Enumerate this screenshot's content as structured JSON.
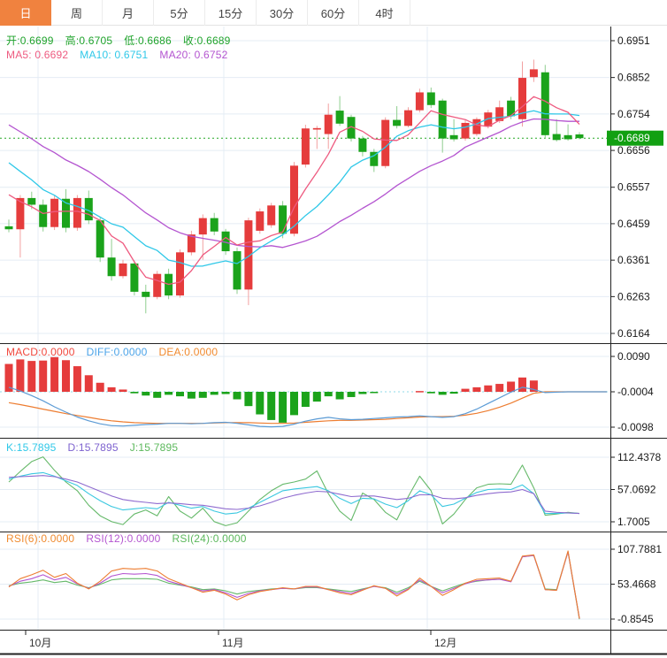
{
  "toolbar": {
    "tabs": [
      {
        "label": "日",
        "active": true
      },
      {
        "label": "周",
        "active": false
      },
      {
        "label": "月",
        "active": false
      },
      {
        "label": "5分",
        "active": false
      },
      {
        "label": "15分",
        "active": false
      },
      {
        "label": "30分",
        "active": false
      },
      {
        "label": "60分",
        "active": false
      },
      {
        "label": "4时",
        "active": false
      }
    ]
  },
  "legends": {
    "ohlc": [
      {
        "text": "开:0.6699",
        "color": "#1fa32b"
      },
      {
        "text": "高:0.6705",
        "color": "#1fa32b"
      },
      {
        "text": "低:0.6686",
        "color": "#1fa32b"
      },
      {
        "text": "收:0.6689",
        "color": "#1fa32b"
      }
    ],
    "ma": [
      {
        "text": "MA5: 0.6692",
        "color": "#ee5b80"
      },
      {
        "text": "MA10: 0.6751",
        "color": "#2fc8e8"
      },
      {
        "text": "MA20: 0.6752",
        "color": "#b455d0"
      }
    ],
    "macd": [
      {
        "text": "MACD:0.0000",
        "color": "#f0483e"
      },
      {
        "text": "DIFF:0.0000",
        "color": "#4aa3e8"
      },
      {
        "text": "DEA:0.0000",
        "color": "#f08a2e"
      }
    ],
    "kdj": [
      {
        "text": "K:15.7895",
        "color": "#2fc8e8"
      },
      {
        "text": "D:15.7895",
        "color": "#7d62cf"
      },
      {
        "text": "J:15.7895",
        "color": "#5cb85c"
      }
    ],
    "rsi": [
      {
        "text": "RSI(6):0.0000",
        "color": "#f08a2e"
      },
      {
        "text": "RSI(12):0.0000",
        "color": "#b455d0"
      },
      {
        "text": "RSI(24):0.0000",
        "color": "#5cb85c"
      }
    ]
  },
  "chart_data": {
    "type": "candlestick+indicators",
    "title": "AUD daily candlestick chart with MACD / KDJ / RSI panes",
    "x_axis": {
      "labels": [
        "10月",
        "11月",
        "12月"
      ]
    },
    "price_axis": {
      "ticks": [
        0.6951,
        0.6852,
        0.6754,
        0.6656,
        0.6557,
        0.6459,
        0.6361,
        0.6263,
        0.6164
      ],
      "last_price": 0.6689
    },
    "ohlc_last": {
      "open": 0.6699,
      "high": 0.6705,
      "low": 0.6686,
      "close": 0.6689
    },
    "ma_values": {
      "ma5": 0.6692,
      "ma10": 0.6751,
      "ma20": 0.6752
    },
    "candles": [
      [
        0.6452,
        0.647,
        0.6436,
        0.6444
      ],
      [
        0.6444,
        0.6536,
        0.6368,
        0.6528
      ],
      [
        0.6528,
        0.6545,
        0.6498,
        0.651
      ],
      [
        0.651,
        0.6524,
        0.6438,
        0.645
      ],
      [
        0.645,
        0.6534,
        0.6442,
        0.6526
      ],
      [
        0.6526,
        0.6552,
        0.6436,
        0.6448
      ],
      [
        0.6448,
        0.6536,
        0.644,
        0.6528
      ],
      [
        0.6528,
        0.6548,
        0.6458,
        0.6468
      ],
      [
        0.6468,
        0.6478,
        0.6356,
        0.6368
      ],
      [
        0.6368,
        0.6418,
        0.6306,
        0.6318
      ],
      [
        0.6318,
        0.6362,
        0.6312,
        0.6352
      ],
      [
        0.6352,
        0.636,
        0.6266,
        0.6276
      ],
      [
        0.6276,
        0.6295,
        0.6218,
        0.6262
      ],
      [
        0.6262,
        0.6332,
        0.6256,
        0.6324
      ],
      [
        0.6324,
        0.6338,
        0.6256,
        0.6266
      ],
      [
        0.6266,
        0.639,
        0.626,
        0.6382
      ],
      [
        0.6382,
        0.644,
        0.6374,
        0.643
      ],
      [
        0.643,
        0.6484,
        0.6362,
        0.6474
      ],
      [
        0.6474,
        0.6488,
        0.6428,
        0.6438
      ],
      [
        0.6438,
        0.6445,
        0.6375,
        0.6385
      ],
      [
        0.6385,
        0.6395,
        0.627,
        0.6282
      ],
      [
        0.6282,
        0.6475,
        0.624,
        0.6468
      ],
      [
        0.644,
        0.65,
        0.6432,
        0.6492
      ],
      [
        0.6455,
        0.6515,
        0.6448,
        0.6508
      ],
      [
        0.6508,
        0.652,
        0.642,
        0.6432
      ],
      [
        0.6432,
        0.6625,
        0.6425,
        0.6615
      ],
      [
        0.6618,
        0.6725,
        0.661,
        0.6715
      ],
      [
        0.6712,
        0.6722,
        0.666,
        0.6716
      ],
      [
        0.67,
        0.6782,
        0.666,
        0.6752
      ],
      [
        0.6763,
        0.6802,
        0.6722,
        0.6728
      ],
      [
        0.6746,
        0.6752,
        0.668,
        0.6688
      ],
      [
        0.6688,
        0.6695,
        0.664,
        0.6652
      ],
      [
        0.6652,
        0.666,
        0.6598,
        0.6614
      ],
      [
        0.6614,
        0.6745,
        0.6608,
        0.6738
      ],
      [
        0.6738,
        0.6775,
        0.6715,
        0.6722
      ],
      [
        0.6722,
        0.6772,
        0.6718,
        0.6764
      ],
      [
        0.6764,
        0.6822,
        0.6758,
        0.6812
      ],
      [
        0.6812,
        0.6825,
        0.677,
        0.6778
      ],
      [
        0.679,
        0.6795,
        0.665,
        0.6688
      ],
      [
        0.6697,
        0.674,
        0.668,
        0.6686
      ],
      [
        0.6688,
        0.6738,
        0.6682,
        0.673
      ],
      [
        0.67,
        0.6745,
        0.6695,
        0.674
      ],
      [
        0.672,
        0.6765,
        0.6715,
        0.6758
      ],
      [
        0.6735,
        0.679,
        0.673,
        0.6772
      ],
      [
        0.679,
        0.68,
        0.674,
        0.6748
      ],
      [
        0.674,
        0.6895,
        0.672,
        0.6851
      ],
      [
        0.6853,
        0.69,
        0.684,
        0.6874
      ],
      [
        0.6866,
        0.6886,
        0.6688,
        0.6697
      ],
      [
        0.67,
        0.674,
        0.668,
        0.6684
      ],
      [
        0.6697,
        0.6726,
        0.6682,
        0.6686
      ],
      [
        0.6699,
        0.6705,
        0.6686,
        0.6689
      ]
    ],
    "ma_seed": [
      0.69,
      0.6885,
      0.687,
      0.6855,
      0.684,
      0.682,
      0.68,
      0.678,
      0.6765,
      0.675,
      0.676,
      0.674,
      0.671,
      0.668,
      0.6655,
      0.662,
      0.658,
      0.654,
      0.65
    ],
    "macd": {
      "axis": [
        0.009,
        -0.0004,
        -0.0098
      ],
      "baseline": -0.0004,
      "bars": [
        0.007,
        0.0082,
        0.0078,
        0.0079,
        0.0088,
        0.008,
        0.0064,
        0.004,
        0.002,
        0.0008,
        0.0002,
        -0.0008,
        -0.0014,
        -0.002,
        -0.0012,
        -0.0016,
        -0.0022,
        -0.002,
        -0.0012,
        -0.001,
        -0.0024,
        -0.0042,
        -0.0064,
        -0.0079,
        -0.0086,
        -0.0066,
        -0.0044,
        -0.003,
        -0.0016,
        -0.0024,
        -0.0018,
        -0.001,
        -0.0007,
        -0.0005,
        -0.0004,
        -0.0004,
        -0.0002,
        -0.0008,
        -0.0012,
        -0.0009,
        0.0004,
        0.0008,
        0.0013,
        0.0017,
        0.0023,
        0.0034,
        0.0026,
        -0.0004,
        -0.0004,
        -0.0004,
        -0.0004
      ],
      "diff": [
        0.0008,
        -0.0002,
        -0.0014,
        -0.0028,
        -0.0044,
        -0.0058,
        -0.0071,
        -0.0081,
        -0.0089,
        -0.0094,
        -0.0095,
        -0.0093,
        -0.0091,
        -0.009,
        -0.0088,
        -0.0088,
        -0.0089,
        -0.0088,
        -0.0086,
        -0.0085,
        -0.0088,
        -0.0092,
        -0.0096,
        -0.0097,
        -0.0096,
        -0.009,
        -0.0082,
        -0.0076,
        -0.0072,
        -0.0076,
        -0.0078,
        -0.0077,
        -0.0075,
        -0.0073,
        -0.0071,
        -0.007,
        -0.0068,
        -0.007,
        -0.0072,
        -0.007,
        -0.0062,
        -0.005,
        -0.0035,
        -0.002,
        -0.0005,
        0.0008,
        0.0002,
        -0.0006,
        -0.0005,
        -0.0004,
        -0.0004
      ],
      "dea": [
        -0.0033,
        -0.0038,
        -0.0044,
        -0.005,
        -0.0056,
        -0.0062,
        -0.0067,
        -0.0072,
        -0.0077,
        -0.0081,
        -0.0084,
        -0.0086,
        -0.0087,
        -0.0088,
        -0.0088,
        -0.0088,
        -0.0088,
        -0.0088,
        -0.0087,
        -0.0086,
        -0.0086,
        -0.0086,
        -0.0087,
        -0.0088,
        -0.0088,
        -0.0087,
        -0.0085,
        -0.0083,
        -0.0081,
        -0.008,
        -0.008,
        -0.0079,
        -0.0078,
        -0.0077,
        -0.0075,
        -0.0073,
        -0.0071,
        -0.007,
        -0.007,
        -0.0069,
        -0.0066,
        -0.0061,
        -0.0054,
        -0.0045,
        -0.0034,
        -0.0021,
        -0.0008,
        -0.0004,
        -0.0004,
        -0.0004,
        -0.0004
      ]
    },
    "kdj": {
      "axis": [
        112.4378,
        57.0692,
        1.7005
      ],
      "k": [
        75,
        80,
        84,
        86,
        80,
        72,
        64,
        50,
        38,
        28,
        22,
        24,
        26,
        24,
        35,
        30,
        25,
        28,
        20,
        15,
        17,
        25,
        35,
        45,
        55,
        58,
        60,
        62,
        55,
        42,
        33,
        42,
        41,
        32,
        26,
        38,
        55,
        48,
        28,
        32,
        42,
        52,
        57,
        58,
        57,
        65,
        50,
        16,
        16,
        17,
        16
      ],
      "d": [
        78,
        79,
        80,
        81,
        79,
        75,
        70,
        62,
        54,
        46,
        40,
        37,
        35,
        33,
        34,
        33,
        31,
        30,
        27,
        24,
        23,
        25,
        29,
        35,
        42,
        47,
        51,
        54,
        53,
        49,
        45,
        46,
        46,
        43,
        40,
        42,
        48,
        48,
        42,
        41,
        43,
        47,
        50,
        52,
        53,
        57,
        50,
        20,
        18,
        17,
        16
      ],
      "j": [
        70,
        88,
        105,
        113,
        90,
        70,
        55,
        30,
        12,
        2,
        -3,
        15,
        22,
        12,
        45,
        20,
        8,
        25,
        2,
        -5,
        0,
        20,
        40,
        55,
        66,
        70,
        75,
        89,
        50,
        20,
        4,
        51,
        40,
        18,
        5,
        45,
        80,
        55,
        -2,
        15,
        40,
        60,
        66,
        67,
        66,
        99,
        60,
        13,
        15,
        18,
        16
      ]
    },
    "rsi": {
      "axis": [
        107.7881,
        53.4668,
        -0.8545
      ],
      "rsi6": [
        49,
        62,
        68,
        75,
        64,
        70,
        55,
        46,
        58,
        74,
        78,
        77,
        78,
        74,
        62,
        55,
        48,
        41,
        44,
        38,
        29,
        37,
        42,
        45,
        48,
        46,
        50,
        50,
        45,
        40,
        37,
        44,
        51,
        47,
        35,
        45,
        63,
        50,
        36,
        45,
        55,
        61,
        62,
        63,
        58,
        97,
        99,
        45,
        44,
        105,
        0
      ],
      "rsi12": [
        50,
        58,
        62,
        68,
        60,
        64,
        54,
        47,
        55,
        66,
        70,
        69,
        70,
        67,
        58,
        53,
        48,
        43,
        45,
        40,
        33,
        39,
        43,
        45,
        47,
        46,
        49,
        49,
        45,
        42,
        39,
        45,
        50,
        47,
        38,
        46,
        60,
        50,
        40,
        47,
        54,
        59,
        60,
        61,
        57,
        96,
        98,
        45,
        44,
        104,
        0
      ],
      "rsi24": [
        51,
        55,
        57,
        60,
        56,
        58,
        52,
        48,
        53,
        60,
        62,
        62,
        62,
        61,
        55,
        52,
        49,
        45,
        46,
        43,
        38,
        42,
        44,
        46,
        47,
        46,
        48,
        48,
        46,
        44,
        42,
        46,
        50,
        48,
        41,
        48,
        58,
        50,
        43,
        49,
        55,
        58,
        60,
        61,
        58,
        96,
        98,
        46,
        45,
        104,
        -1
      ]
    },
    "colors": {
      "up": "#e53c3c",
      "up_wick": "#f2a0a0",
      "down": "#1ba31b",
      "down_wick": "#8fce8f",
      "ma5": "#ee5b80",
      "ma10": "#2fc8e8",
      "ma20": "#b455d0",
      "diff": "#5b9bd5",
      "dea": "#ed7d31",
      "k": "#3bc8e0",
      "d": "#8f6bcf",
      "j": "#66b96a",
      "rsi6": "#ed7d31",
      "rsi12": "#b455d0",
      "rsi24": "#66b96a",
      "grid": "#e4ecf4",
      "zero_dash": "#8fd9e8",
      "price_line": "#27a827",
      "badge_bg": "#12a012",
      "badge_text": "#ffffff",
      "axis_text": "#1a1a1a",
      "border": "#222222"
    }
  }
}
